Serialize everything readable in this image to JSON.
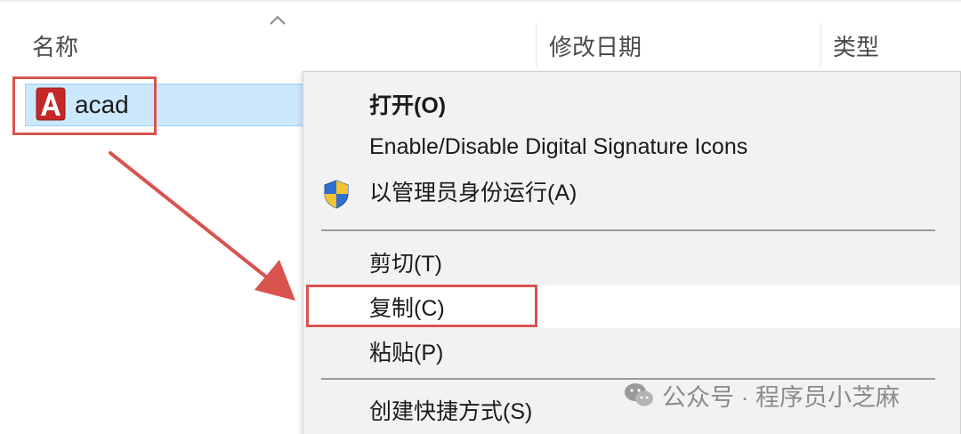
{
  "explorer": {
    "columns": {
      "name": "名称",
      "date_modified": "修改日期",
      "type": "类型"
    },
    "file": {
      "name": "acad",
      "icon": "autocad-icon"
    }
  },
  "context_menu": {
    "items": [
      {
        "label": "打开(O)",
        "bold": true
      },
      {
        "label": "Enable/Disable Digital Signature Icons"
      },
      {
        "label": "以管理员身份运行(A)",
        "icon": "uac-shield-icon"
      },
      {
        "label": "剪切(T)"
      },
      {
        "label": "复制(C)"
      },
      {
        "label": "粘贴(P)"
      },
      {
        "label": "创建快捷方式(S)"
      }
    ]
  },
  "watermark": {
    "text": "公众号 · 程序员小芝麻",
    "icon": "wechat-icon"
  },
  "colors": {
    "annotation_red": "#d9534f",
    "selection_blue": "#cce8ff",
    "menu_bg": "#f2f2f2"
  }
}
